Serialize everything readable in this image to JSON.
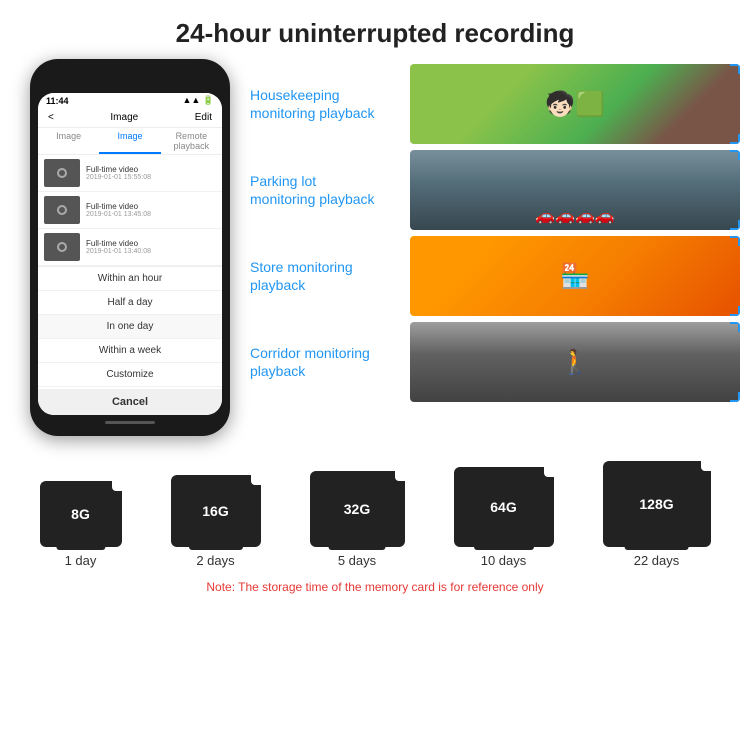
{
  "header": {
    "title": "24-hour uninterrupted recording"
  },
  "phone": {
    "time": "11:44",
    "nav_title": "Image",
    "nav_edit": "Edit",
    "nav_back": "<",
    "tabs": [
      {
        "label": "Image",
        "active": false
      },
      {
        "label": "Image",
        "active": true
      },
      {
        "label": "Remote playback",
        "active": false
      }
    ],
    "list_items": [
      {
        "title": "Full-time video",
        "subtitle": "2019-01-01 15:55:08"
      },
      {
        "title": "Full-time video",
        "subtitle": "2019-01-01 13:45:08"
      },
      {
        "title": "Full-time video",
        "subtitle": "2019-01-01 13:40:08"
      }
    ],
    "dropdown_items": [
      "Within an hour",
      "Half a day",
      "In one day",
      "Within a week",
      "Customize"
    ],
    "cancel_label": "Cancel"
  },
  "monitoring": [
    {
      "label": "Housekeeping\nmonitoring playback",
      "img_type": "housekeeping"
    },
    {
      "label": "Parking lot\nmonitoring playback",
      "img_type": "parking"
    },
    {
      "label": "Store monitoring\nplayback",
      "img_type": "store"
    },
    {
      "label": "Corridor monitoring\nplayback",
      "img_type": "corridor"
    }
  ],
  "sd_cards": [
    {
      "size": "8G",
      "days": "1 day"
    },
    {
      "size": "16G",
      "days": "2 days"
    },
    {
      "size": "32G",
      "days": "5 days"
    },
    {
      "size": "64G",
      "days": "10 days"
    },
    {
      "size": "128G",
      "days": "22 days"
    }
  ],
  "note": "Note: The storage time of the memory card is for reference only"
}
